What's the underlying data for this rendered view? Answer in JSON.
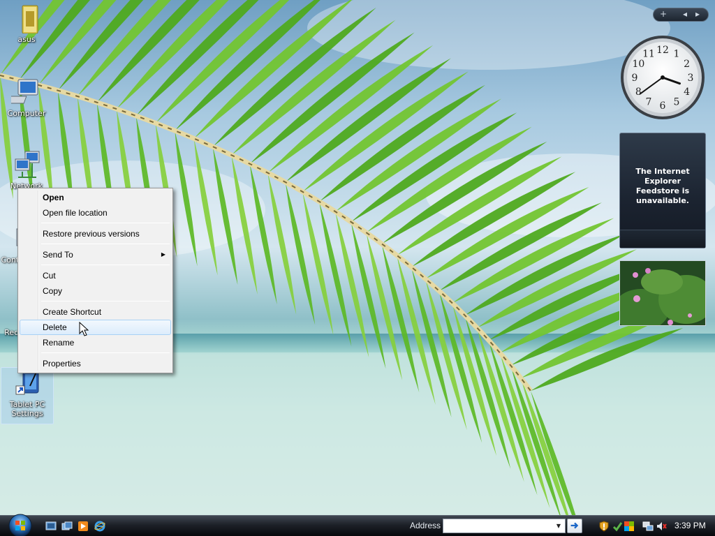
{
  "desktop": {
    "icons": [
      {
        "label": "asus"
      },
      {
        "label": "Computer"
      },
      {
        "label": "Network"
      },
      {
        "label": "Control Panel"
      },
      {
        "label": "Recycle Bin"
      },
      {
        "label": "Tablet PC Settings"
      }
    ]
  },
  "context_menu": {
    "items": [
      {
        "label": "Open",
        "bold": true
      },
      {
        "label": "Open file location"
      },
      {
        "label": "Restore previous versions"
      },
      {
        "label": "Send To",
        "submenu": true
      },
      {
        "label": "Cut"
      },
      {
        "label": "Copy"
      },
      {
        "label": "Create Shortcut"
      },
      {
        "label": "Delete",
        "highlighted": true
      },
      {
        "label": "Rename"
      },
      {
        "label": "Properties"
      }
    ],
    "submenu_arrow": "▶"
  },
  "sidebar": {
    "controls": {
      "add": "+",
      "prev": "◂",
      "next": "▸"
    },
    "clock": {
      "numerals": [
        "12",
        "1",
        "2",
        "3",
        "4",
        "5",
        "6",
        "7",
        "8",
        "9",
        "10",
        "11"
      ],
      "hour": 3,
      "minute": 39
    },
    "feed_gadget": {
      "message": "The Internet Explorer Feedstore is unavailable."
    }
  },
  "taskbar": {
    "address_label": "Address",
    "address_value": "",
    "address_dropdown": "▼",
    "time": "3:39 PM"
  },
  "colors": {
    "taskbar_dark": "#07090c",
    "menu_bg": "#f1f1f1",
    "menu_highlight": "#dcecfc",
    "leaf_green": "#5cb825"
  }
}
